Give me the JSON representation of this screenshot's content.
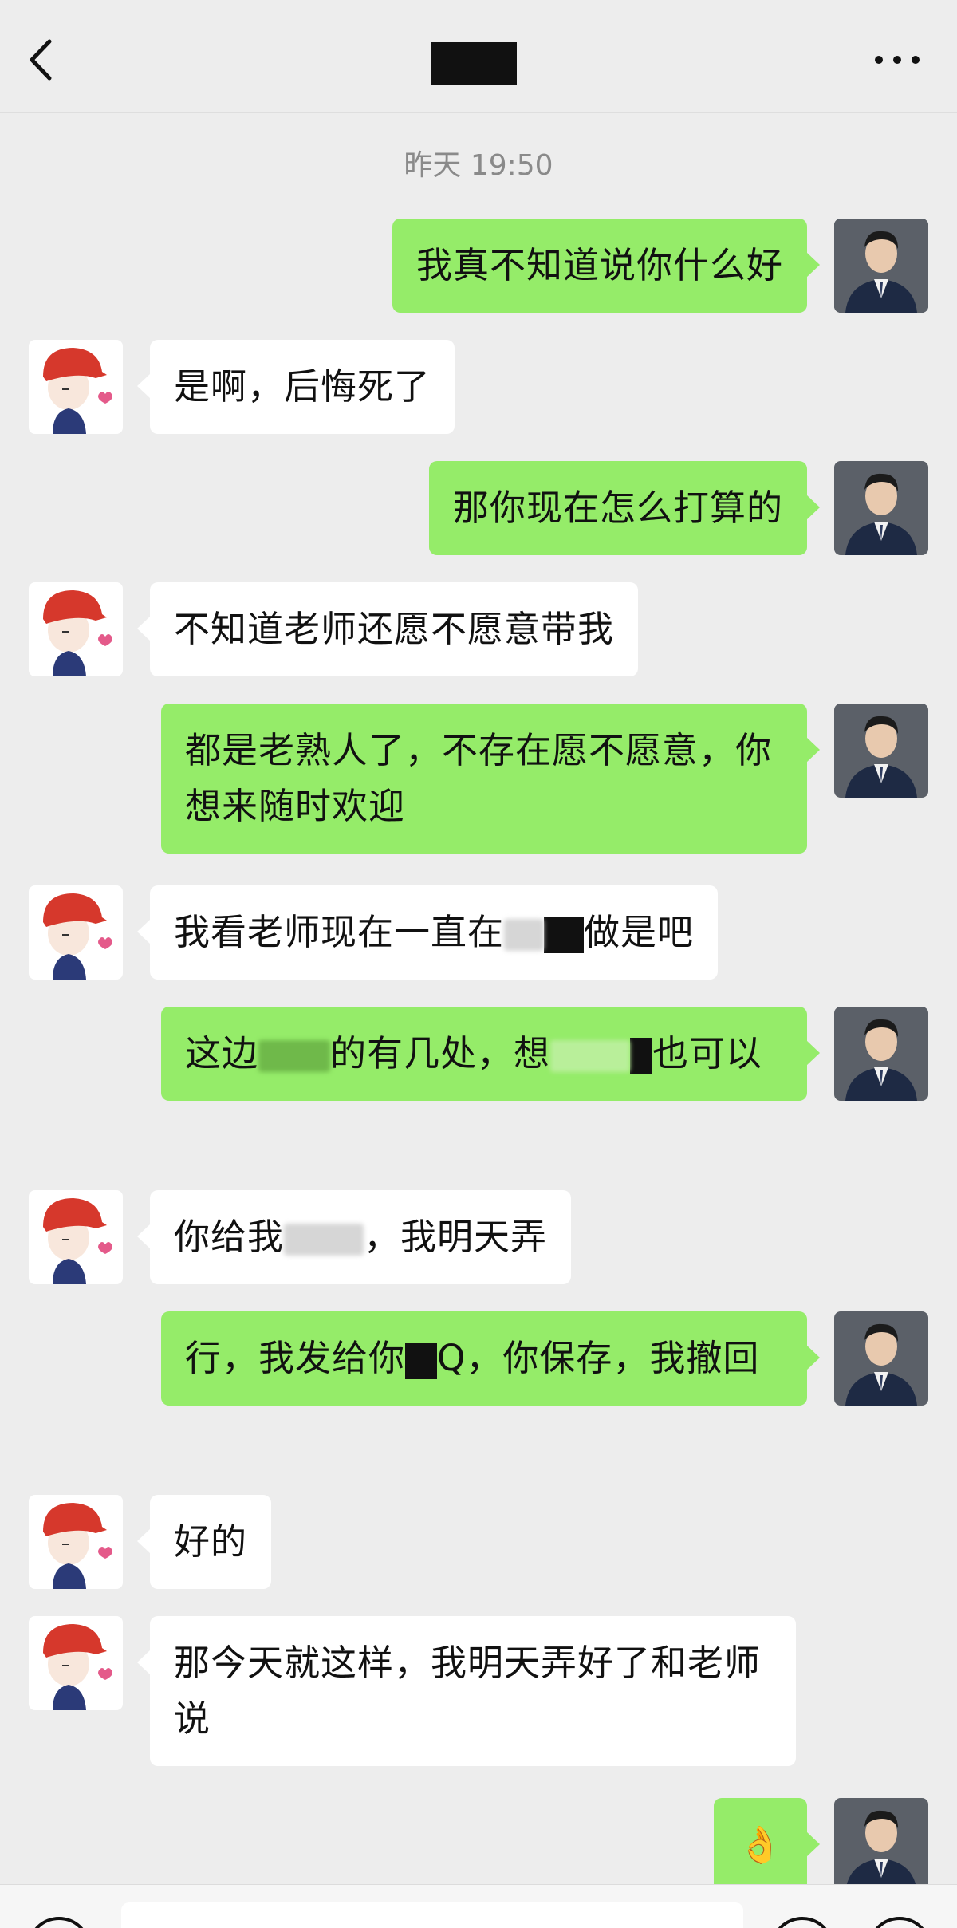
{
  "header": {
    "back_icon": "chevron-left-icon",
    "more_icon": "more-dots-icon"
  },
  "timestamp": "昨天 19:50",
  "messages": [
    {
      "side": "right",
      "text": "我真不知道说你什么好"
    },
    {
      "side": "left",
      "text": "是啊，后悔死了"
    },
    {
      "side": "right",
      "text": "那你现在怎么打算的"
    },
    {
      "side": "left",
      "text": "不知道老师还愿不愿意带我"
    },
    {
      "side": "right",
      "text": "都是老熟人了，不存在愿不愿意，你想来随时欢迎"
    },
    {
      "side": "left",
      "text_a": "我看老师现在一直在",
      "text_b": "做是吧"
    },
    {
      "side": "right",
      "text_a": "这边",
      "text_b": "的有几处，想",
      "text_c": "也可以"
    },
    {
      "side": "left",
      "text_a": "你给我",
      "text_b": "，我明天弄"
    },
    {
      "side": "right",
      "text_a": "行，我发给你",
      "text_b": "Q，你保存，我撤回"
    },
    {
      "side": "left",
      "text": "好的"
    },
    {
      "side": "left",
      "text": "那今天就这样，我明天弄好了和老师说"
    },
    {
      "side": "right",
      "text": "👌"
    }
  ],
  "colors": {
    "background": "#ededed",
    "self_bubble": "#95ec69",
    "other_bubble": "#ffffff"
  }
}
